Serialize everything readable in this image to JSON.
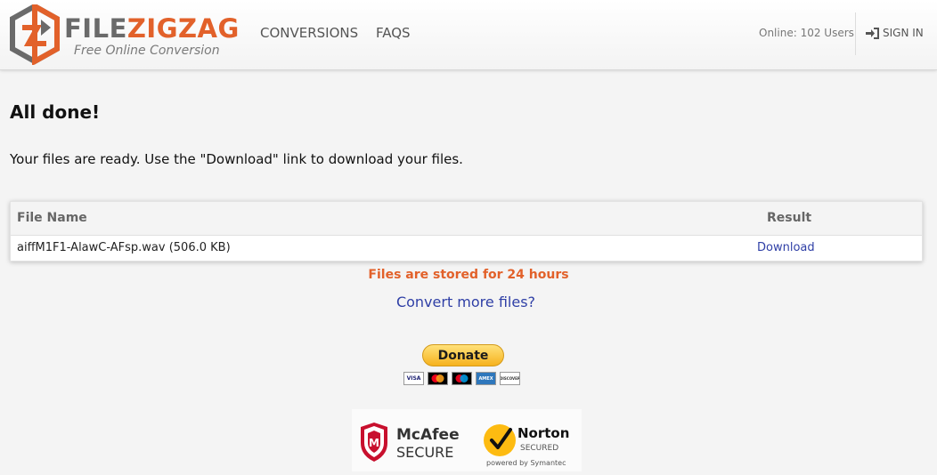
{
  "brand": {
    "name_part1": "FILE",
    "name_part2": "ZIGZAG",
    "tagline": "Free Online Conversion",
    "colors": {
      "orange": "#e2612a",
      "gray": "#6a6a6a",
      "link": "#2f3fa6"
    }
  },
  "nav": {
    "conversions": "CONVERSIONS",
    "faqs": "FAQS",
    "online_users": "Online: 102 Users",
    "sign_in": "SIGN IN",
    "sign_in_icon": "sign-in-icon"
  },
  "page": {
    "title": "All done!",
    "message": "Your files are ready. Use the \"Download\" link to download your files."
  },
  "results": {
    "columns": [
      "File Name",
      "Result"
    ],
    "rows": [
      {
        "file_name": "aiffM1F1-AlawC-AFsp.wav (506.0 KB)",
        "result": "Download"
      }
    ]
  },
  "notice": "Files are stored for 24 hours",
  "convert_more": "Convert more files?",
  "donate": {
    "label": "Donate",
    "cards": [
      "VISA",
      "",
      "",
      "AMEX",
      "DISCOVER"
    ]
  },
  "trust": {
    "mcafee_line1": "McAfee",
    "mcafee_line2": "SECURE",
    "norton_line1": "Norton",
    "norton_line2": "SECURED",
    "norton_line3": "powered by Symantec"
  }
}
